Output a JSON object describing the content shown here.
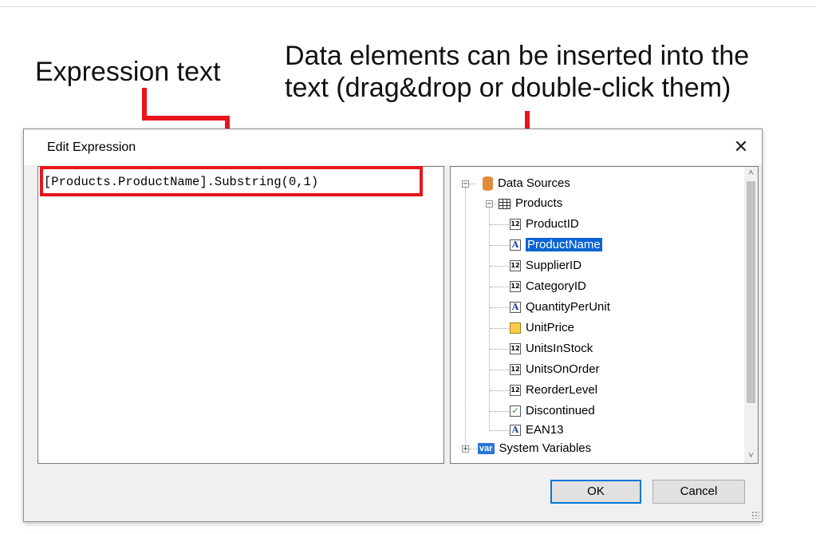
{
  "callouts": {
    "left": "Expression text",
    "right_line1": "Data elements can be inserted into the",
    "right_line2": "text (drag&drop or double-click them)"
  },
  "dialog": {
    "title": "Edit Expression",
    "close_symbol": "✕",
    "expression": "[Products.ProductName].Substring(0,1)",
    "tree": {
      "data_sources_label": "Data Sources",
      "products_label": "Products",
      "fields": [
        {
          "label": "ProductID",
          "icon": "number-icon",
          "glyph": "12"
        },
        {
          "label": "ProductName",
          "icon": "text-field-icon",
          "glyph": "A",
          "selected": true
        },
        {
          "label": "SupplierID",
          "icon": "number-icon",
          "glyph": "12"
        },
        {
          "label": "CategoryID",
          "icon": "number-icon",
          "glyph": "12"
        },
        {
          "label": "QuantityPerUnit",
          "icon": "text-field-icon",
          "glyph": "A"
        },
        {
          "label": "UnitPrice",
          "icon": "currency-icon",
          "glyph": ""
        },
        {
          "label": "UnitsInStock",
          "icon": "number-icon",
          "glyph": "12"
        },
        {
          "label": "UnitsOnOrder",
          "icon": "number-icon",
          "glyph": "12"
        },
        {
          "label": "ReorderLevel",
          "icon": "number-icon",
          "glyph": "12"
        },
        {
          "label": "Discontinued",
          "icon": "checkbox-icon",
          "glyph": "✓"
        },
        {
          "label": "EAN13",
          "icon": "text-field-icon",
          "glyph": "A"
        }
      ],
      "system_variables_label": "System Variables",
      "var_badge": "var",
      "collapse_symbol": "−",
      "expand_symbol": "+"
    },
    "scroll_up_symbol": "˄",
    "scroll_down_symbol": "˅",
    "ok_label": "OK",
    "cancel_label": "Cancel"
  },
  "colors": {
    "callout_line": "#e8141c",
    "selection": "#0a64d4",
    "ok_border": "#0078d7"
  }
}
